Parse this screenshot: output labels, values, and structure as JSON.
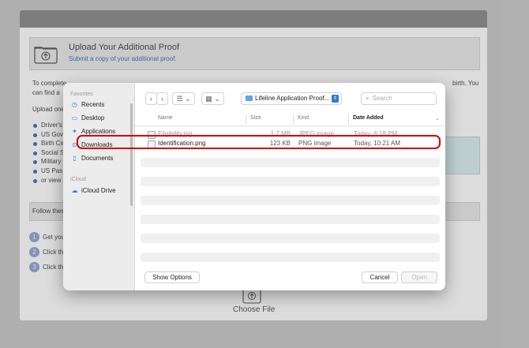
{
  "background": {
    "upload_title": "Upload Your Additional Proof",
    "upload_subtitle": "Submit a copy of your additional proof.",
    "intro_line1": "To complete",
    "intro_line1_right": "birth. You",
    "intro_line2": "can find a",
    "upload_line": "Upload one",
    "bullets": [
      "Driver's",
      "US Gov",
      "Birth Ce",
      "Social S",
      "Military",
      "US Pas",
      "or view"
    ],
    "follow_text": "Follow thes",
    "steps": [
      {
        "num": "1",
        "text": "Get you"
      },
      {
        "num": "2",
        "text": "Click th"
      },
      {
        "num": "3",
        "text": "Click th"
      }
    ],
    "choose_file_label": "Choose File"
  },
  "dialog": {
    "sidebar": {
      "favorites_heading": "Favorites",
      "favorites": [
        {
          "label": "Recents",
          "icon": "clock-icon"
        },
        {
          "label": "Desktop",
          "icon": "desktop-icon"
        },
        {
          "label": "Applications",
          "icon": "applications-icon"
        },
        {
          "label": "Downloads",
          "icon": "downloads-icon"
        },
        {
          "label": "Documents",
          "icon": "documents-icon"
        }
      ],
      "icloud_heading": "iCloud",
      "icloud_items": [
        {
          "label": "iCloud Drive",
          "icon": "cloud-icon"
        }
      ]
    },
    "toolbar": {
      "back_glyph": "‹",
      "forward_glyph": "›",
      "list_view_glyph": "☰ ⌄",
      "grid_view_glyph": "▦ ⌄",
      "location": "Lifeline Application Proof...",
      "search_placeholder": "Search"
    },
    "columns": {
      "name": "Name",
      "size": "Size",
      "kind": "Kind",
      "date_added": "Date Added",
      "sort_glyph": "⌄"
    },
    "files": [
      {
        "name": "Eligibility.jpg",
        "size": "1.7 MB",
        "kind": "JPEG image",
        "date": "Today, 6:18 PM"
      },
      {
        "name": "Identification.png",
        "size": "123 KB",
        "kind": "PNG image",
        "date": "Today, 10:21 AM"
      }
    ],
    "buttons": {
      "show_options": "Show Options",
      "cancel": "Cancel",
      "open": "Open"
    },
    "highlight_color": "#d40000",
    "accent_color": "#2f7bd8"
  }
}
